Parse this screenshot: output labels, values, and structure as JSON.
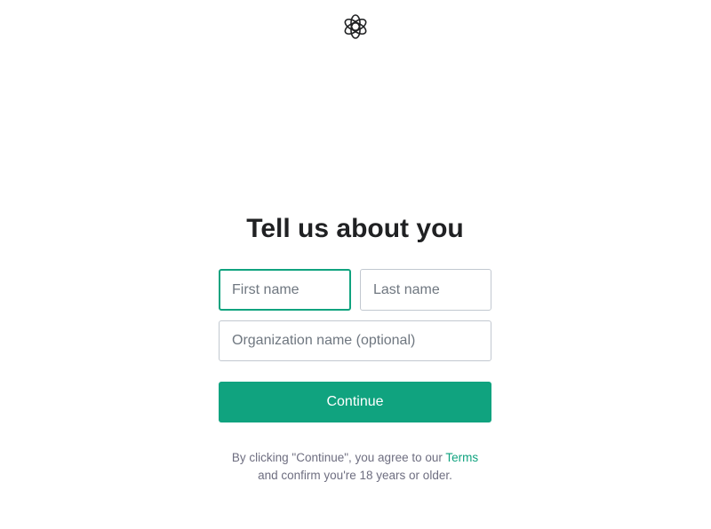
{
  "brand": {
    "logo_icon": "openai-knot-icon",
    "accent_color": "#10a37f"
  },
  "form": {
    "title": "Tell us about you",
    "first_name": {
      "value": "",
      "placeholder": "First name"
    },
    "last_name": {
      "value": "",
      "placeholder": "Last name"
    },
    "organization": {
      "value": "",
      "placeholder": "Organization name (optional)"
    },
    "continue_label": "Continue"
  },
  "legal": {
    "line1_prefix": "By clicking \"Continue\", you agree to our ",
    "terms_link": "Terms",
    "line2": "and confirm you're 18 years or older."
  }
}
